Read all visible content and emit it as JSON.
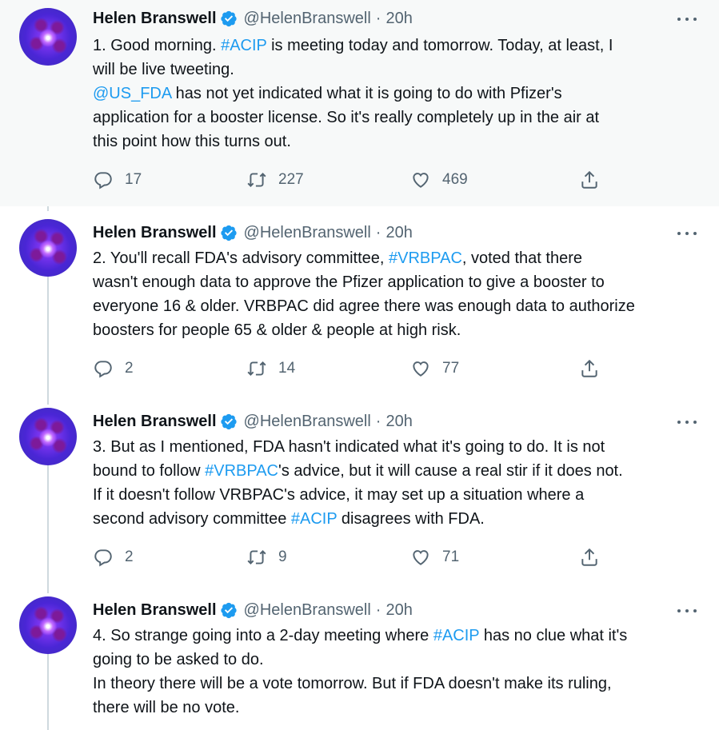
{
  "tweets": [
    {
      "author": "Helen Branswell",
      "handle": "@HelenBranswell",
      "dot": "·",
      "time": "20h",
      "body": [
        [
          {
            "t": "1. Good morning. "
          },
          {
            "t": "#ACIP",
            "link": true
          },
          {
            "t": " is meeting today and tomorrow. Today, at least, I"
          }
        ],
        [
          {
            "t": "will be live tweeting."
          }
        ],
        [
          {
            "t": "@US_FDA",
            "link": true
          },
          {
            "t": " has not yet indicated what it is going to do with Pfizer's"
          }
        ],
        [
          {
            "t": "application for a booster license. So it's really completely up in the air at"
          }
        ],
        [
          {
            "t": "this point how this turns out."
          }
        ]
      ],
      "replies": "17",
      "retweets": "227",
      "likes": "469"
    },
    {
      "author": "Helen Branswell",
      "handle": "@HelenBranswell",
      "dot": "·",
      "time": "20h",
      "body": [
        [
          {
            "t": "2. You'll recall FDA's advisory committee, "
          },
          {
            "t": "#VRBPAC",
            "link": true
          },
          {
            "t": ", voted that there"
          }
        ],
        [
          {
            "t": "wasn't enough data to approve the Pfizer application to give a booster to"
          }
        ],
        [
          {
            "t": "everyone 16 & older. VRBPAC did agree there was enough data to authorize"
          }
        ],
        [
          {
            "t": "boosters for people 65 & older & people at high risk."
          }
        ]
      ],
      "replies": "2",
      "retweets": "14",
      "likes": "77"
    },
    {
      "author": "Helen Branswell",
      "handle": "@HelenBranswell",
      "dot": "·",
      "time": "20h",
      "body": [
        [
          {
            "t": "3. But as I mentioned, FDA hasn't indicated what it's going to do. It is not"
          }
        ],
        [
          {
            "t": "bound to follow "
          },
          {
            "t": "#VRBPAC",
            "link": true
          },
          {
            "t": "'s advice, but it will cause a real stir if it does not."
          }
        ],
        [
          {
            "t": "If it doesn't follow VRBPAC's advice, it may set up a situation where a"
          }
        ],
        [
          {
            "t": "second advisory committee "
          },
          {
            "t": "#ACIP",
            "link": true
          },
          {
            "t": " disagrees with FDA."
          }
        ]
      ],
      "replies": "2",
      "retweets": "9",
      "likes": "71"
    },
    {
      "author": "Helen Branswell",
      "handle": "@HelenBranswell",
      "dot": "·",
      "time": "20h",
      "body": [
        [
          {
            "t": "4. So strange going into a 2-day meeting where "
          },
          {
            "t": "#ACIP",
            "link": true
          },
          {
            "t": " has no clue what it's"
          }
        ],
        [
          {
            "t": "going to be asked to do."
          }
        ],
        [
          {
            "t": "In theory there will be a vote tomorrow. But if FDA doesn't make its ruling,"
          }
        ],
        [
          {
            "t": "there will be no vote."
          }
        ]
      ]
    }
  ],
  "colors": {
    "link": "#1d9bf0",
    "muted": "#536471",
    "highlight_bg": "#f7f9f9",
    "thread_line": "#cfd9de"
  },
  "icons": [
    "verified-badge-icon",
    "more-icon",
    "reply-icon",
    "retweet-icon",
    "like-icon",
    "share-icon"
  ]
}
